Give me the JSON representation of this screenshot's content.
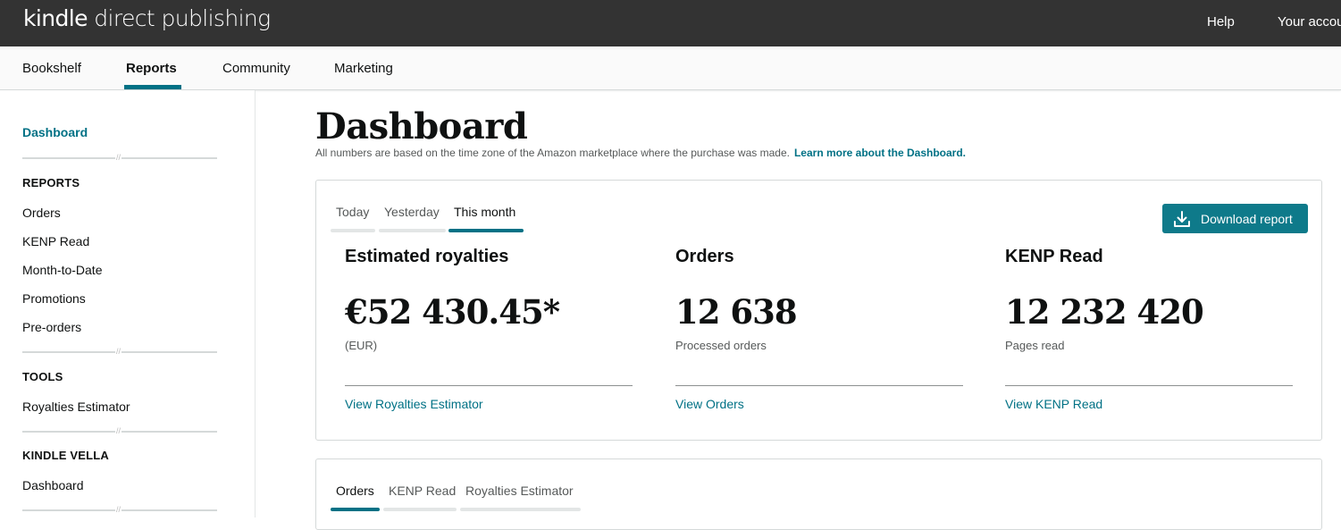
{
  "header": {
    "logo_kindle": "kindle",
    "logo_rest": " direct publishing",
    "help": "Help",
    "account": "Your account"
  },
  "nav": {
    "bookshelf": "Bookshelf",
    "reports": "Reports",
    "community": "Community",
    "marketing": "Marketing"
  },
  "sidebar": {
    "dashboard": "Dashboard",
    "reports_heading": "REPORTS",
    "reports_items": [
      "Orders",
      "KENP Read",
      "Month-to-Date",
      "Promotions",
      "Pre-orders"
    ],
    "tools_heading": "TOOLS",
    "tools_items": [
      "Royalties Estimator"
    ],
    "vella_heading": "KINDLE VELLA",
    "vella_items": [
      "Dashboard"
    ]
  },
  "main": {
    "title": "Dashboard",
    "subtitle": "All numbers are based on the time zone of the Amazon marketplace where the purchase was made.",
    "learn_more": "Learn more about the Dashboard.",
    "period_tabs": [
      "Today",
      "Yesterday",
      "This month"
    ],
    "active_period": "This month",
    "download_button": "Download report",
    "stats": [
      {
        "title": "Estimated royalties",
        "value": "€52 430.45*",
        "label": "(EUR)",
        "link": "View Royalties Estimator"
      },
      {
        "title": "Orders",
        "value": "12 638",
        "label": "Processed orders",
        "link": "View Orders"
      },
      {
        "title": "KENP Read",
        "value": "12 232 420",
        "label": "Pages read",
        "link": "View KENP Read"
      }
    ],
    "bottom_tabs": [
      "Orders",
      "KENP Read",
      "Royalties Estimator"
    ],
    "active_bottom_tab": "Orders"
  },
  "colors": {
    "header_bg": "#333333",
    "accent": "#007185",
    "button_bg": "#0e7a8a"
  }
}
